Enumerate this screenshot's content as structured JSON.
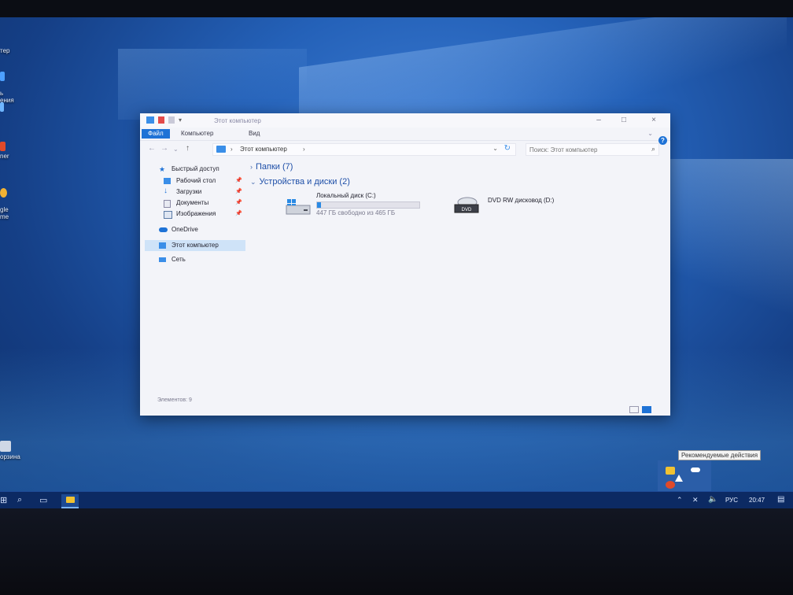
{
  "window": {
    "title": "Этот компьютер",
    "ribbon_tabs": [
      "Файл",
      "Компьютер",
      "Вид"
    ],
    "address": {
      "crumb": "Этот компьютер"
    },
    "search_placeholder": "Поиск: Этот компьютер",
    "nav": {
      "quick_access": "Быстрый доступ",
      "desktop": "Рабочий стол",
      "downloads": "Загрузки",
      "documents": "Документы",
      "pictures": "Изображения",
      "onedrive": "OneDrive",
      "this_pc": "Этот компьютер",
      "network": "Сеть"
    },
    "groups": {
      "folders": "Папки (7)",
      "devices": "Устройства и диски (2)"
    },
    "drives": [
      {
        "name": "Локальный диск (C:)",
        "free": "447 ГБ свободно из 465 ГБ",
        "used_fraction": 0.04
      },
      {
        "name": "DVD RW дисковод (D:)"
      }
    ],
    "status": "Элементов: 9"
  },
  "desktop_icons": [
    {
      "label": "тер"
    },
    {
      "label": "ь\nения"
    },
    {
      "label": "ner"
    },
    {
      "label": "gle\nme"
    },
    {
      "label": "орзина"
    }
  ],
  "tray": {
    "tooltip": "Рекомендуемые действия",
    "language": "РУС",
    "time": "20:47"
  },
  "colors": {
    "accent": "#1e72d6",
    "taskbar": "#0c2a63",
    "desktop": "#2461b8"
  }
}
